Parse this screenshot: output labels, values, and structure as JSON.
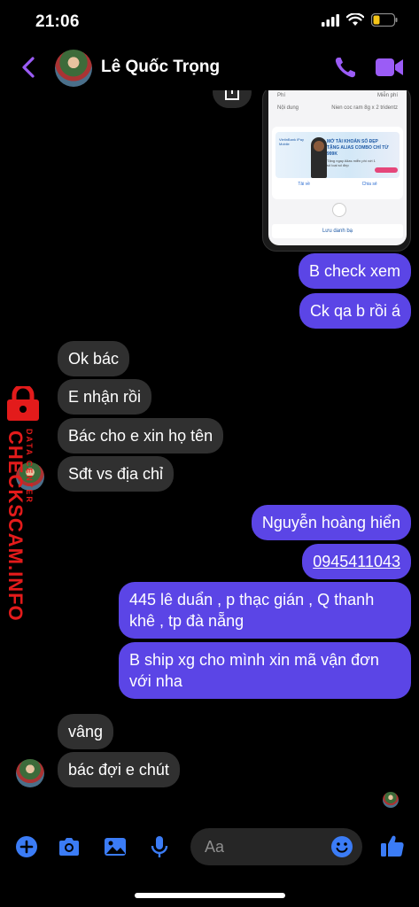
{
  "status_bar": {
    "time": "21:06"
  },
  "header": {
    "contact_name": "Lê Quốc Trọng"
  },
  "shared_image": {
    "rows": [
      {
        "label": "Phí",
        "value": "Miễn phí"
      },
      {
        "label": "Nội dung",
        "value": "Nien coc ram 8g x 2 tridentz"
      }
    ],
    "ad_text": "MỞ TÀI KHOẢN SỐ ĐẸP TẶNG ALIAS COMBO CHỈ TỪ 999K",
    "ad_subtext": "Tặng ngay Alias miễn phí với 1 số loại số đẹp",
    "brand": "VietinBank iPay Mobile",
    "download_label": "Tải về",
    "share_label": "Chia sẻ",
    "save_contact_label": "Lưu danh bạ"
  },
  "messages": [
    {
      "side": "out",
      "text": "B check xem"
    },
    {
      "side": "out",
      "text": "Ck qa b rồi á"
    },
    {
      "side": "in",
      "text": "Ok bác"
    },
    {
      "side": "in",
      "text": "E nhận rồi"
    },
    {
      "side": "in",
      "text": "Bác cho e xin họ tên"
    },
    {
      "side": "in",
      "text": "Sđt vs địa chỉ"
    },
    {
      "side": "out",
      "text": "Nguyễn hoàng hiển"
    },
    {
      "side": "out",
      "text": "0945411043"
    },
    {
      "side": "out",
      "text": "445 lê duẩn , p thạc gián , Q thanh khê , tp đà nẵng"
    },
    {
      "side": "out",
      "text": "B ship xg cho mình xin mã vận đơn với nha"
    },
    {
      "side": "in",
      "text": "vâng"
    },
    {
      "side": "in",
      "text": "bác đợi e chút"
    }
  ],
  "watermark": {
    "text": "CHECKSCAM.INFO",
    "subtext": "DATA CENTER"
  },
  "composer": {
    "placeholder": "Aa"
  },
  "colors": {
    "accent": "#5b45e6",
    "icon_blue": "#3b7cf6",
    "header_purple": "#9b5cf6",
    "incoming": "#303030",
    "watermark_red": "#e31b1b"
  }
}
